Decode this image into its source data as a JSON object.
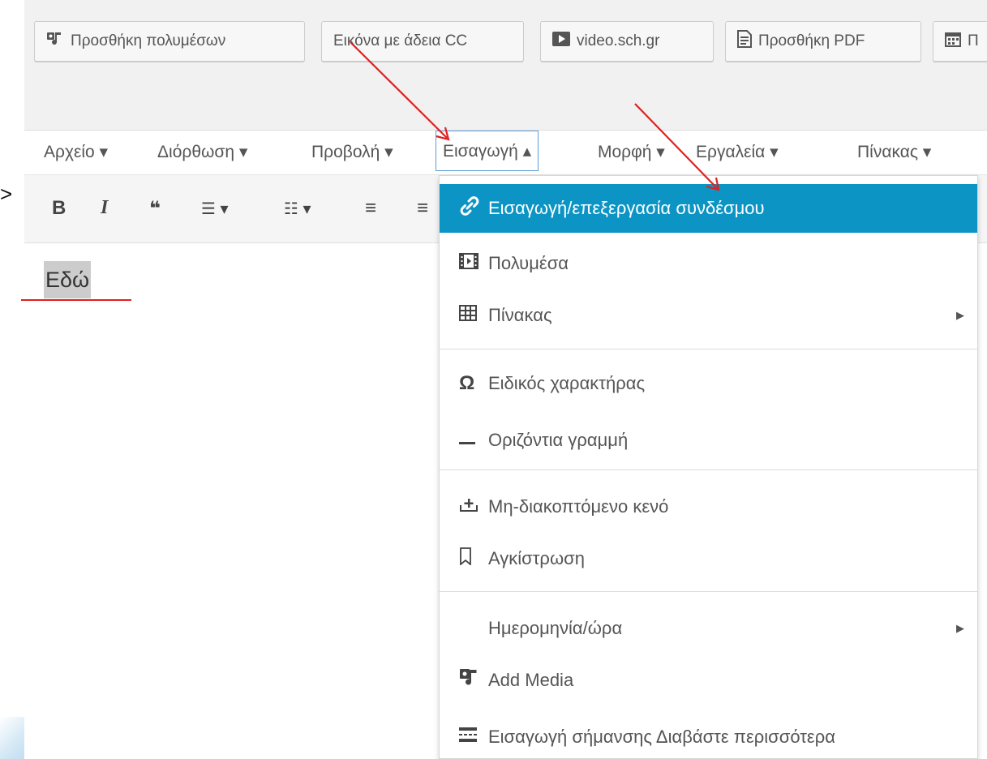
{
  "media_buttons": [
    {
      "label": "Προσθήκη πολυμέσων",
      "icon": "media-icon"
    },
    {
      "label": "Εικόνα με άδεια CC",
      "icon": ""
    },
    {
      "label": "video.sch.gr",
      "icon": "video-icon"
    },
    {
      "label": "Προσθήκη PDF",
      "icon": "pdf-icon"
    },
    {
      "label": "Π",
      "icon": "calendar-icon"
    }
  ],
  "menubar": {
    "file": "Αρχείο ▾",
    "edit": "Διόρθωση ▾",
    "view": "Προβολή ▾",
    "insert": "Εισαγωγή ▴",
    "format": "Μορφή ▾",
    "tools": "Εργαλεία ▾",
    "table": "Πίνακας ▾"
  },
  "toolbar": {
    "bold": "B",
    "italic": "I",
    "quote": "❝",
    "bullets": "☰ ▾",
    "numbered": "☷ ▾",
    "align_left": "≡",
    "align_center": "≡"
  },
  "editor": {
    "selected_text": "Εδώ"
  },
  "left_edge_glyph": ">",
  "insert_menu": {
    "items": [
      {
        "label": "Εισαγωγή/επεξεργασία συνδέσμου",
        "icon": "link-icon",
        "highlighted": true
      },
      {
        "label": "Πολυμέσα",
        "icon": "film-icon"
      },
      {
        "label": "Πίνακας",
        "icon": "table-icon",
        "submenu": true
      },
      {
        "label": "Ειδικός χαρακτήρας",
        "icon": "omega-icon"
      },
      {
        "label": "Οριζόντια γραμμή",
        "icon": "horizontal-line-icon"
      },
      {
        "label": "Μη-διακοπτόμενο κενό",
        "icon": "nbsp-icon"
      },
      {
        "label": "Αγκίστρωση",
        "icon": "bookmark-icon"
      },
      {
        "label": "Ημερομηνία/ώρα",
        "icon": "",
        "submenu": true
      },
      {
        "label": "Add Media",
        "icon": "media-icon"
      },
      {
        "label": "Εισαγωγή σήμανσης Διαβάστε περισσότερα",
        "icon": "read-more-icon"
      }
    ]
  },
  "colors": {
    "highlight": "#0c95c4",
    "annotation_red": "#e02020",
    "focus_border": "#5b9dd9"
  }
}
